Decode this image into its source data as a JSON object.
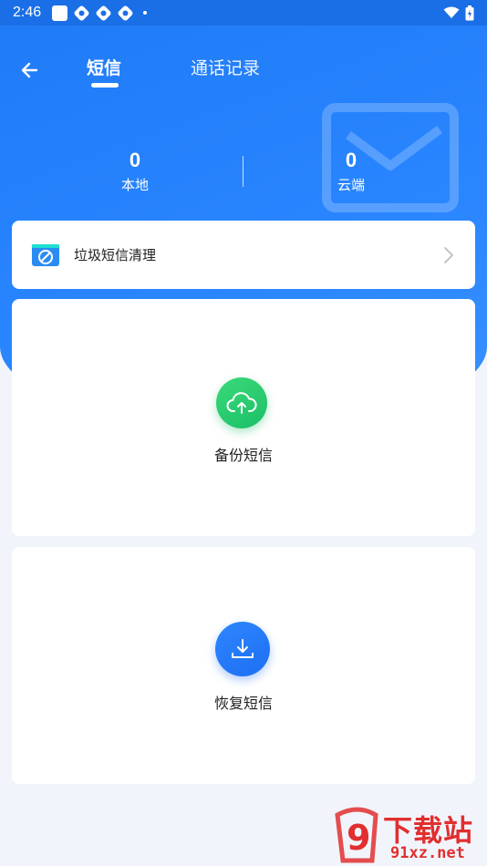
{
  "status_bar": {
    "time": "2:46"
  },
  "nav": {
    "tab_sms": "短信",
    "tab_calls": "通话记录"
  },
  "stats": {
    "local_count": "0",
    "local_label": "本地",
    "cloud_count": "0",
    "cloud_label": "云端"
  },
  "junk": {
    "label": "垃圾短信清理"
  },
  "backup": {
    "label": "备份短信"
  },
  "restore": {
    "label": "恢复短信"
  },
  "watermark": {
    "line1": "下载站",
    "line2": "91xz.net",
    "mark": "9"
  },
  "colors": {
    "brand_blue": "#2a86ff",
    "backup_green": "#1bc066",
    "restore_blue": "#1c6ff2",
    "watermark_red": "#e02f2f"
  }
}
